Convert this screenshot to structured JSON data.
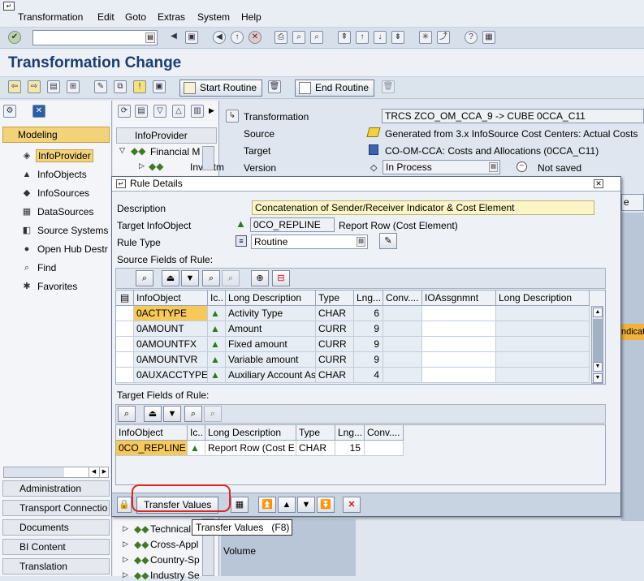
{
  "menu": [
    "Transformation",
    "Edit",
    "Goto",
    "Extras",
    "System",
    "Help"
  ],
  "page_title": "Transformation Change",
  "app_toolbar": {
    "start_routine": "Start Routine",
    "end_routine": "End Routine"
  },
  "left_nav": {
    "modeling": "Modeling",
    "items": [
      "InfoProvider",
      "InfoObjects",
      "InfoSources",
      "DataSources",
      "Source Systems",
      "Open Hub Destr",
      "Find",
      "Favorites"
    ],
    "sections": [
      "Administration",
      "Transport Connectio",
      "Documents",
      "BI Content",
      "Translation"
    ]
  },
  "tree": {
    "header": "InfoProvider",
    "items": [
      "Financial M",
      "Investm"
    ],
    "bottom_items": [
      "Technical",
      "Cross-Appl",
      "Country-Sp",
      "Industry Se"
    ]
  },
  "header_fields": {
    "transformation_label": "Transformation",
    "transformation_value": "TRCS ZCO_OM_CCA_9 -> CUBE 0CCA_C11",
    "source_label": "Source",
    "source_value": "Generated from 3.x InfoSource Cost Centers: Actual Costs",
    "target_label": "Target",
    "target_value": "CO-OM-CCA: Costs and Allocations (0CCA_C11)",
    "version_label": "Version",
    "version_value": "In Process",
    "save_status": "Not saved"
  },
  "background_fragments": {
    "right_edge_1": "e",
    "right_edge_2": "ndicat",
    "volume": "Volume"
  },
  "dialog": {
    "title": "Rule Details",
    "description_label": "Description",
    "description_value": "Concatenation of Sender/Receiver Indicator & Cost Element",
    "target_io_label": "Target InfoObject",
    "target_io_value": "0CO_REPLINE",
    "target_io_text": "Report Row (Cost Element)",
    "rule_type_label": "Rule Type",
    "rule_type_value": "Routine",
    "source_fields_label": "Source Fields of Rule:",
    "source_columns": [
      "InfoObject",
      "Ic..",
      "Long Description",
      "Type",
      "Lng...",
      "Conv....",
      "IOAssgnmnt",
      "Long Description"
    ],
    "source_rows": [
      {
        "io": "0ACTTYPE",
        "desc": "Activity Type",
        "type": "CHAR",
        "len": "6"
      },
      {
        "io": "0AMOUNT",
        "desc": "Amount",
        "type": "CURR",
        "len": "9"
      },
      {
        "io": "0AMOUNTFX",
        "desc": "Fixed amount",
        "type": "CURR",
        "len": "9"
      },
      {
        "io": "0AMOUNTVR",
        "desc": "Variable amount",
        "type": "CURR",
        "len": "9"
      },
      {
        "io": "0AUXACCTYPE",
        "desc": "Auxiliary Account As",
        "type": "CHAR",
        "len": "4"
      }
    ],
    "target_fields_label": "Target Fields of Rule:",
    "target_columns": [
      "InfoObject",
      "Ic..",
      "Long Description",
      "Type",
      "Lng...",
      "Conv...."
    ],
    "target_rows": [
      {
        "io": "0CO_REPLINE",
        "desc": "Report Row (Cost E",
        "type": "CHAR",
        "len": "15"
      }
    ],
    "transfer_button": "Transfer Values"
  },
  "tooltip": "Transfer Values   (F8)"
}
